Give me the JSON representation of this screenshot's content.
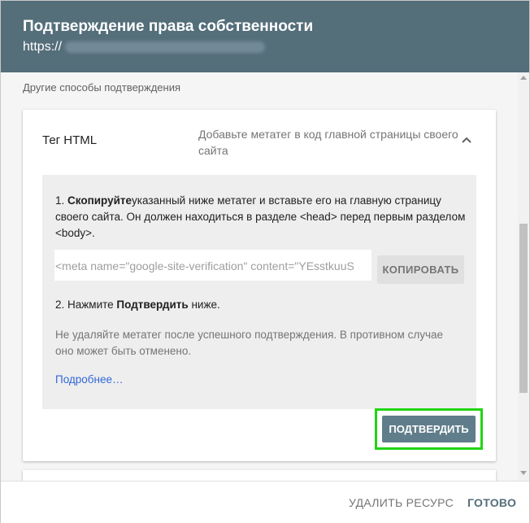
{
  "header": {
    "title": "Подтверждение права собственности",
    "url_prefix": "https://"
  },
  "section_label": "Другие способы подтверждения",
  "card": {
    "title": "Тег HTML",
    "description": "Добавьте метатег в код главной страницы своего сайта",
    "step1_bold": "Скопируйте",
    "step1_rest": "указанный ниже метатег и вставьте его на главную страницу своего сайта. Он должен находиться в разделе <head> перед первым разделом <body>.",
    "step1_prefix": "1. ",
    "meta_value": "<meta name=\"google-site-verification\" content=\"YEsstkuuS",
    "copy_label": "КОПИРОВАТЬ",
    "step2_prefix": "2. Нажмите ",
    "step2_bold": "Подтвердить",
    "step2_suffix": " ниже.",
    "note": "Не удаляйте метатег после успешного подтверждения. В противном случае оно может быть отменено.",
    "more_link": "Подробнее…",
    "confirm_label": "ПОДТВЕРДИТЬ"
  },
  "footer": {
    "delete_label": "УДАЛИТЬ РЕСУРС",
    "done_label": "ГОТОВО"
  },
  "colors": {
    "header_bg": "#546e7a",
    "confirm_bg": "#607d8b",
    "highlight": "#22d414",
    "link": "#3367d6"
  }
}
